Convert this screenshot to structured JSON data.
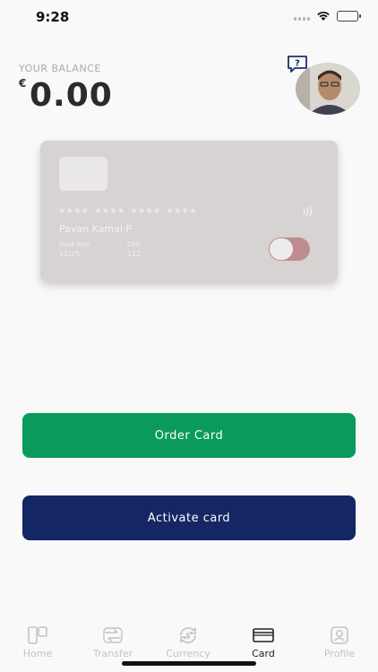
{
  "status_bar": {
    "time": "9:28"
  },
  "balance": {
    "label": "YOUR BALANCE",
    "currency_symbol": "€",
    "amount": "0.00"
  },
  "header_icons": {
    "help": "help-chat-icon",
    "avatar": "user-avatar"
  },
  "card": {
    "number": "**** **** **** ****",
    "holder_name": "Pavan Kamal P",
    "valid_label": "Valid thru",
    "valid_value": "11/25",
    "cvv_label": "CVV",
    "cvv_value": "112",
    "toggle_state": "on"
  },
  "actions": {
    "order_label": "Order Card",
    "activate_label": "Activate card"
  },
  "tabs": [
    {
      "label": "Home",
      "icon": "home-icon"
    },
    {
      "label": "Transfer",
      "icon": "transfer-icon"
    },
    {
      "label": "Currency",
      "icon": "currency-icon"
    },
    {
      "label": "Card",
      "icon": "card-icon",
      "active": true
    },
    {
      "label": "Profile",
      "icon": "profile-icon"
    }
  ],
  "colors": {
    "order_button": "#0a9a5c",
    "activate_button": "#142663",
    "card_background": "#d8d3d3"
  }
}
